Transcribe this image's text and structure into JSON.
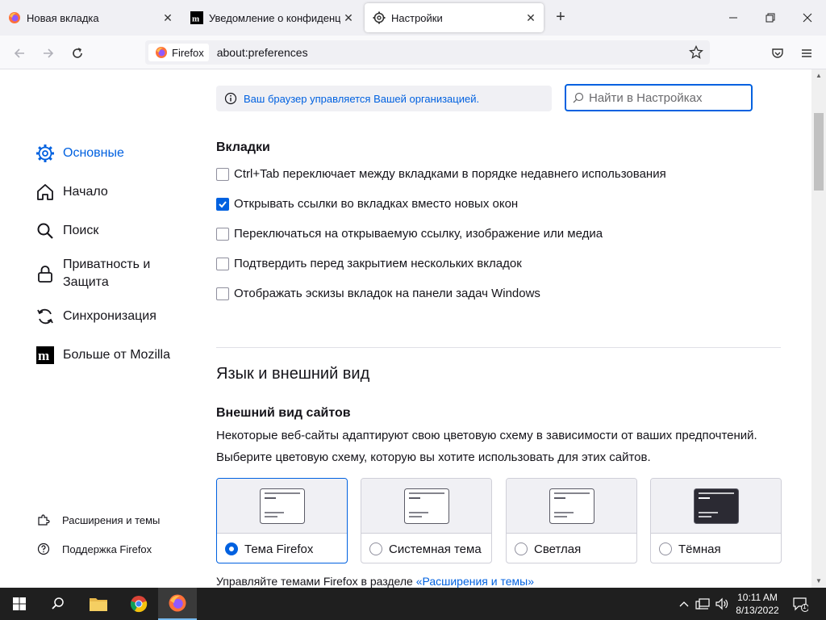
{
  "tabs": [
    {
      "title": "Новая вкладка",
      "icon": "firefox-icon"
    },
    {
      "title": "Уведомление о конфиденциальности",
      "icon": "mozilla-icon"
    },
    {
      "title": "Настройки",
      "icon": "gear-icon"
    }
  ],
  "url": {
    "identity_label": "Firefox",
    "address": "about:preferences"
  },
  "sidebar": {
    "items": [
      {
        "label": "Основные",
        "icon": "gear-icon",
        "selected": true
      },
      {
        "label": "Начало",
        "icon": "home-icon"
      },
      {
        "label": "Поиск",
        "icon": "search-icon"
      },
      {
        "label": "Приватность и Защита",
        "icon": "lock-icon"
      },
      {
        "label": "Синхронизация",
        "icon": "sync-icon"
      },
      {
        "label": "Больше от Mozilla",
        "icon": "mozilla-icon"
      }
    ],
    "footer": [
      {
        "label": "Расширения и темы",
        "icon": "puzzle-icon"
      },
      {
        "label": "Поддержка Firefox",
        "icon": "help-icon"
      }
    ]
  },
  "notice": "Ваш браузер управляется Вашей организацией.",
  "search": {
    "placeholder": "Найти в Настройках",
    "value": ""
  },
  "tabs_section": {
    "heading": "Вкладки",
    "options": [
      {
        "label": "Ctrl+Tab переключает между вкладками в порядке недавнего использования",
        "checked": false
      },
      {
        "label": "Открывать ссылки во вкладках вместо новых окон",
        "checked": true
      },
      {
        "label": "Переключаться на открываемую ссылку, изображение или медиа",
        "checked": false
      },
      {
        "label": "Подтвердить перед закрытием нескольких вкладок",
        "checked": false
      },
      {
        "label": "Отображать эскизы вкладок на панели задач Windows",
        "checked": false
      }
    ]
  },
  "language_section": {
    "heading": "Язык и внешний вид",
    "subheading": "Внешний вид сайтов",
    "desc1": "Некоторые веб-сайты адаптируют свою цветовую схему в зависимости от ваших предпочтений.",
    "desc2": "Выберите цветовую схему, которую вы хотите использовать для этих сайтов.",
    "themes": [
      {
        "label": "Тема Firefox",
        "selected": true,
        "dark": false
      },
      {
        "label": "Системная тема",
        "selected": false,
        "dark": false
      },
      {
        "label": "Светлая",
        "selected": false,
        "dark": false
      },
      {
        "label": "Тёмная",
        "selected": false,
        "dark": true
      }
    ],
    "manage_prefix": "Управляйте темами Firefox в разделе ",
    "manage_link": "«Расширения и темы»"
  },
  "taskbar": {
    "time": "10:11 AM",
    "date": "8/13/2022",
    "notification_count": "1"
  },
  "colors": {
    "accent": "#0061e0",
    "taskbar": "#1f1f1f"
  }
}
